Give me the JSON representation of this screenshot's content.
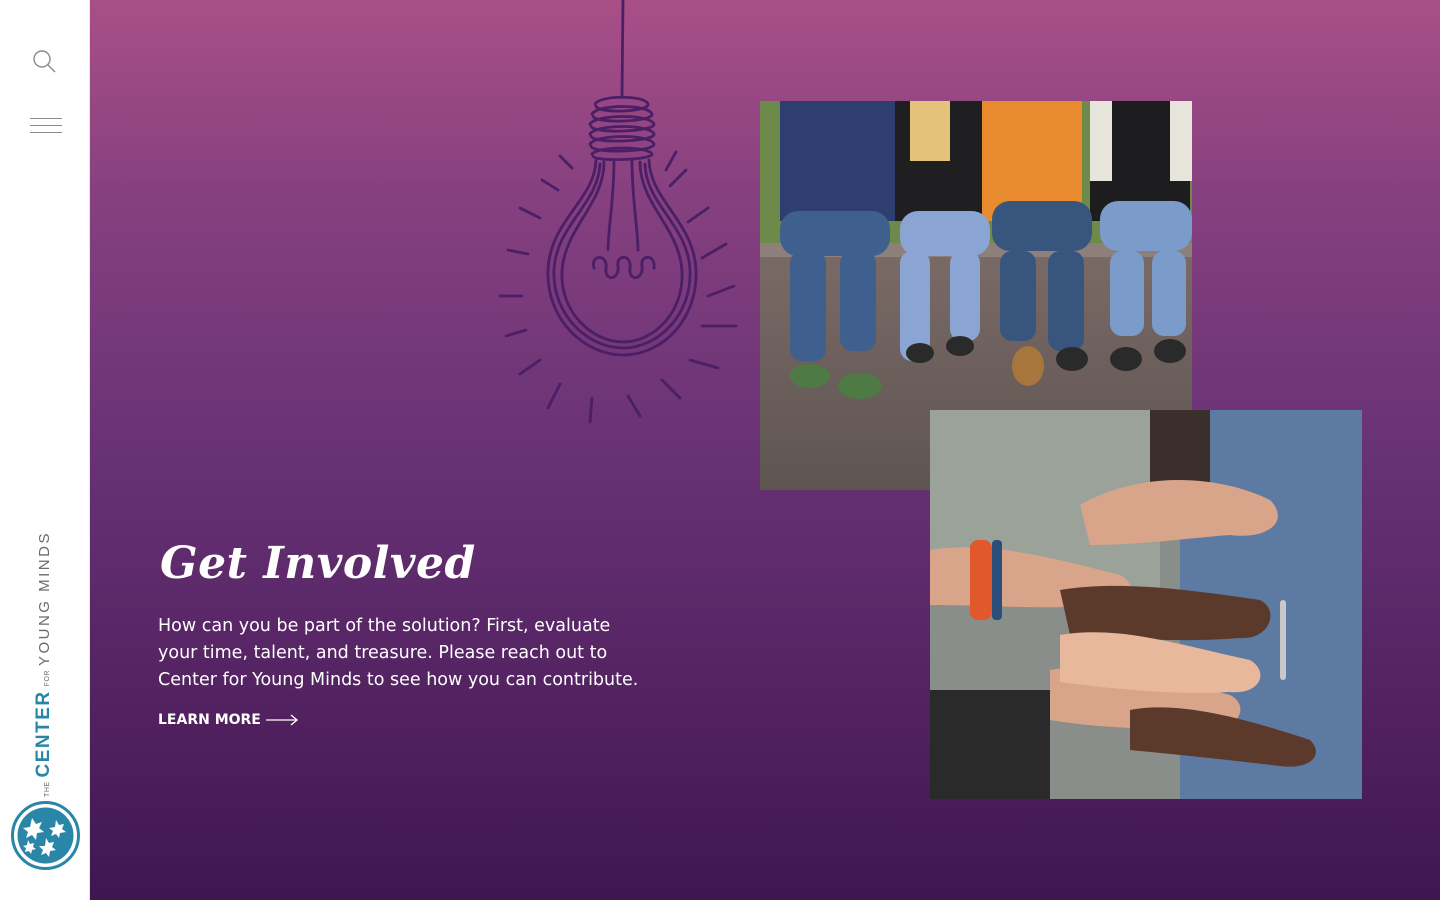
{
  "sidebar": {
    "search_icon": "search-icon",
    "menu_icon": "hamburger-menu-icon",
    "brand": {
      "the": "THE",
      "center": "CENTER",
      "for": "FOR",
      "young_minds": "YOUNG MINDS"
    },
    "logo_icon": "leaf-circle-logo-icon"
  },
  "hero": {
    "illustration_icon": "lightbulb-icon",
    "heading": "Get Involved",
    "body": "How can you be part of the solution? First, evaluate your time, talent, and treasure. Please reach out to Center for Young Minds to see how you can contribute.",
    "cta_label": "LEARN MORE",
    "cta_icon": "arrow-right-icon"
  },
  "colors": {
    "gradient_top": "#a84f87",
    "gradient_bottom": "#3f1650",
    "brand_teal": "#2a86a6",
    "bulb_stroke": "#4a1f66"
  }
}
